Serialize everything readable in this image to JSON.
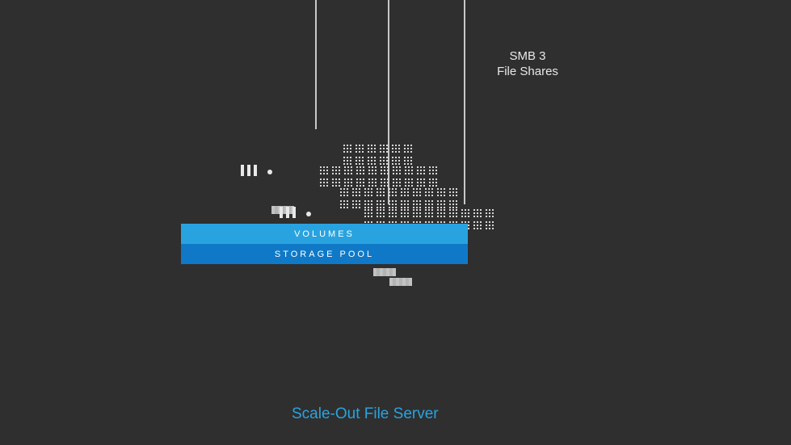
{
  "labels": {
    "smb_line1": "SMB 3",
    "smb_line2": "File Shares"
  },
  "bars": {
    "volumes": "VOLUMES",
    "pool": "STORAGE POOL"
  },
  "footer": "Scale-Out File Server",
  "colors": {
    "bg": "#2f2f2f",
    "accent": "#29a3e0",
    "accent_dark": "#0f79c7",
    "text_light": "#e8e8e8"
  }
}
